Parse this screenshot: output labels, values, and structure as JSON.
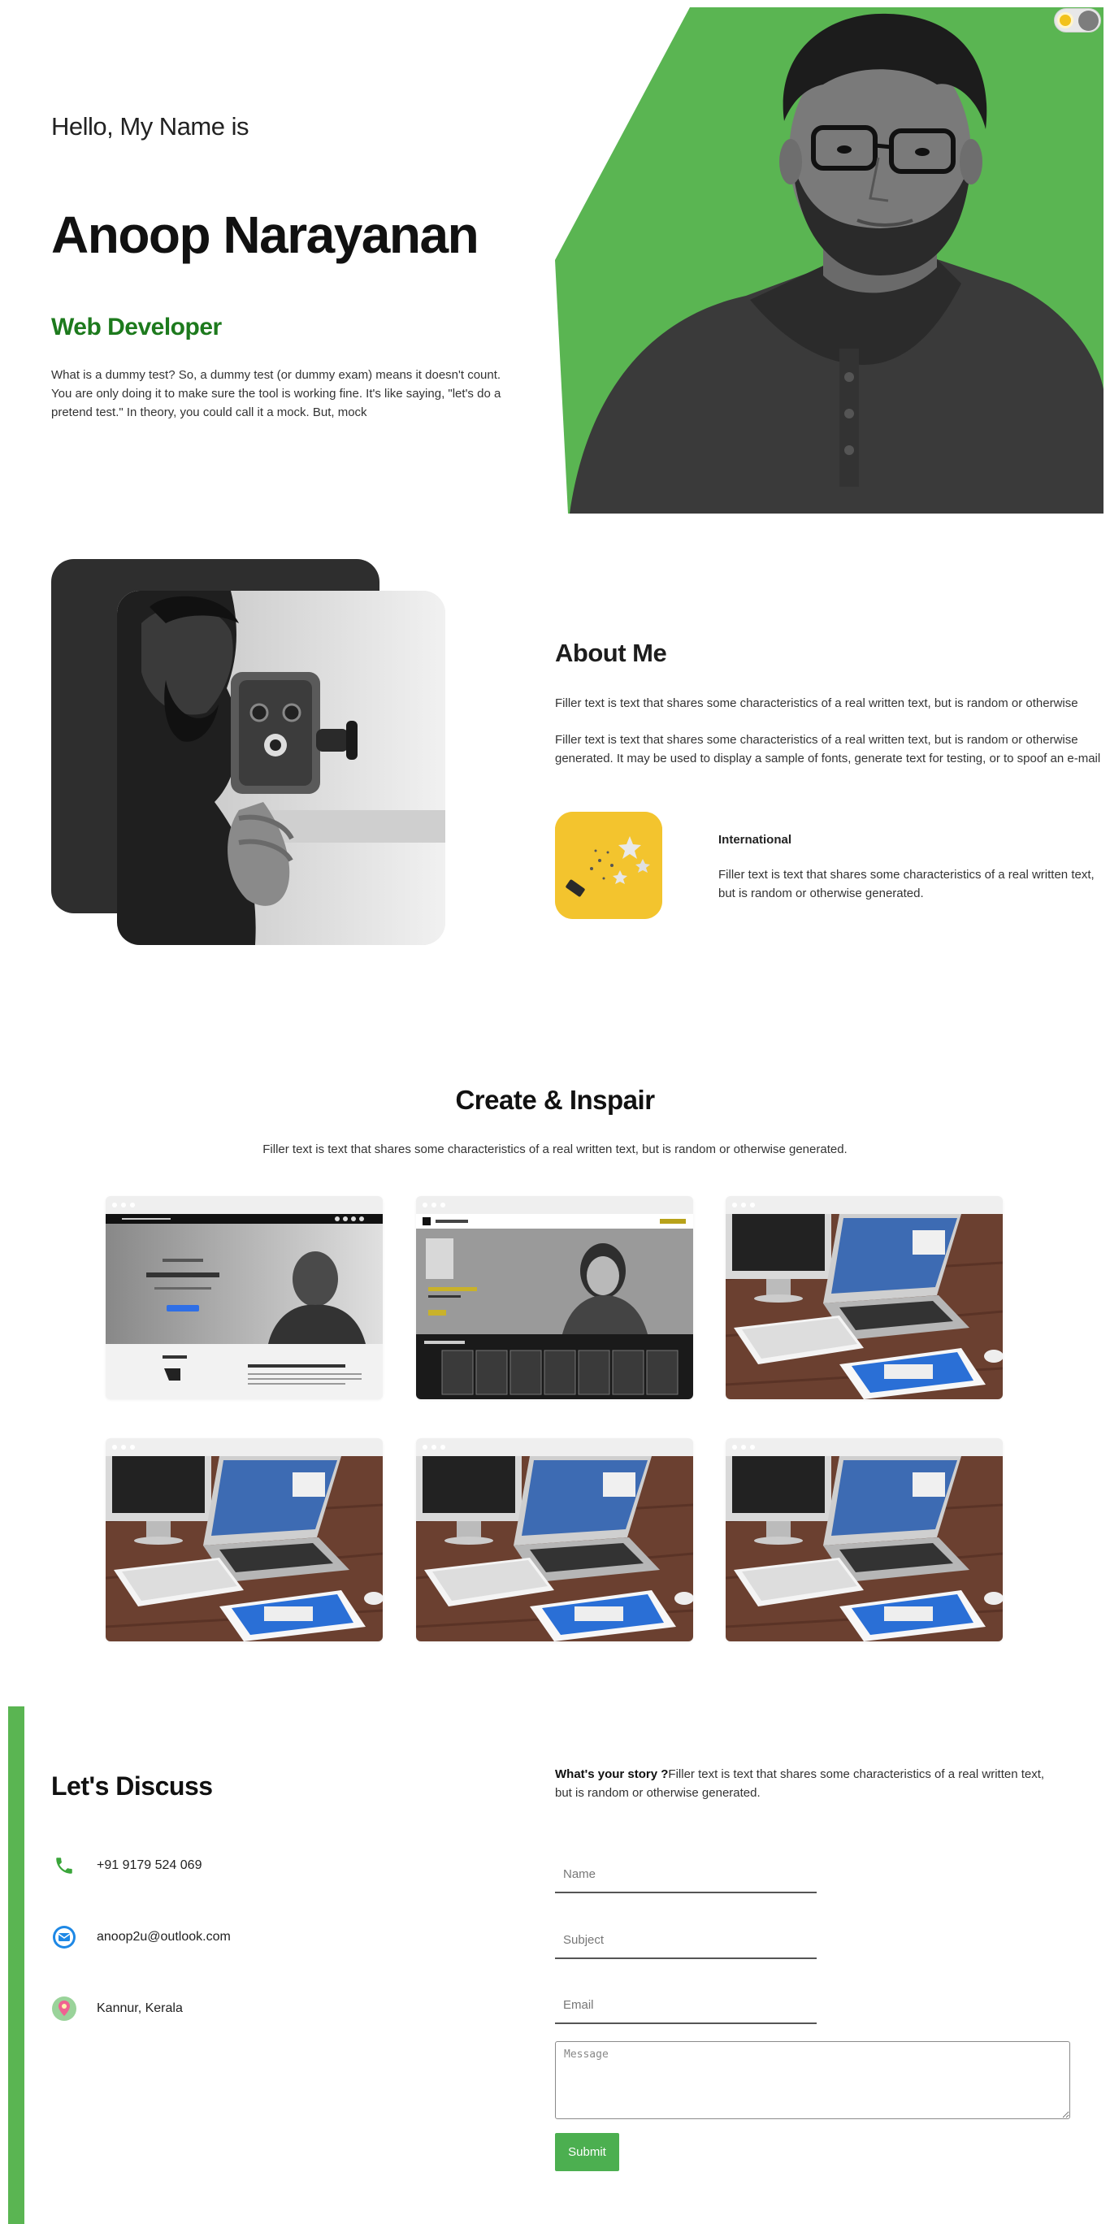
{
  "hero": {
    "greeting": "Hello, My Name is",
    "name": "Anoop Narayanan",
    "role": "Web Developer",
    "description": "What is a dummy test? So, a dummy test (or dummy exam) means it doesn't count. You are only doing it to make sure the tool is working fine. It's like saying, \"let's do a pretend test.\" In theory, you could call it a mock. But, mock",
    "accent_color": "#5ab552",
    "role_color": "#1d7a1d"
  },
  "theme_toggle": {
    "icon": "sun-icon",
    "state": "light"
  },
  "about": {
    "title": "About Me",
    "paragraph_1": "Filler text is text that shares some characteristics of a real written text, but is random or otherwise",
    "paragraph_2": "Filler text is text that shares some characteristics of a real written text, but is random or otherwise generated. It may be used to display a sample of fonts, generate text for testing, or to spoof an e-mail",
    "feature": {
      "title": "International",
      "text": "Filler text is text that shares some characteristics of a real written text, but is random or otherwise generated."
    }
  },
  "portfolio": {
    "title": "Create & Inspair",
    "subtitle": "Filler text is text that shares some characteristics of a real written text, but is random or otherwise generated.",
    "items": [
      {
        "kind": "site-anoop"
      },
      {
        "kind": "site-author"
      },
      {
        "kind": "desk-mockup"
      },
      {
        "kind": "desk-mockup"
      },
      {
        "kind": "desk-mockup"
      },
      {
        "kind": "desk-mockup"
      }
    ]
  },
  "contact": {
    "title": "Let's Discuss",
    "phone": "+91 9179 524 069",
    "email": "anoop2u@outlook.com",
    "location": "Kannur, Kerala",
    "story_lead": "What's your story ?",
    "story_text": "Filler text is text that shares some characteristics of a real written text, but is random or otherwise generated.",
    "form": {
      "name_placeholder": "Name",
      "subject_placeholder": "Subject",
      "email_placeholder": "Email",
      "message_placeholder": "Message",
      "submit_label": "Submit"
    }
  }
}
